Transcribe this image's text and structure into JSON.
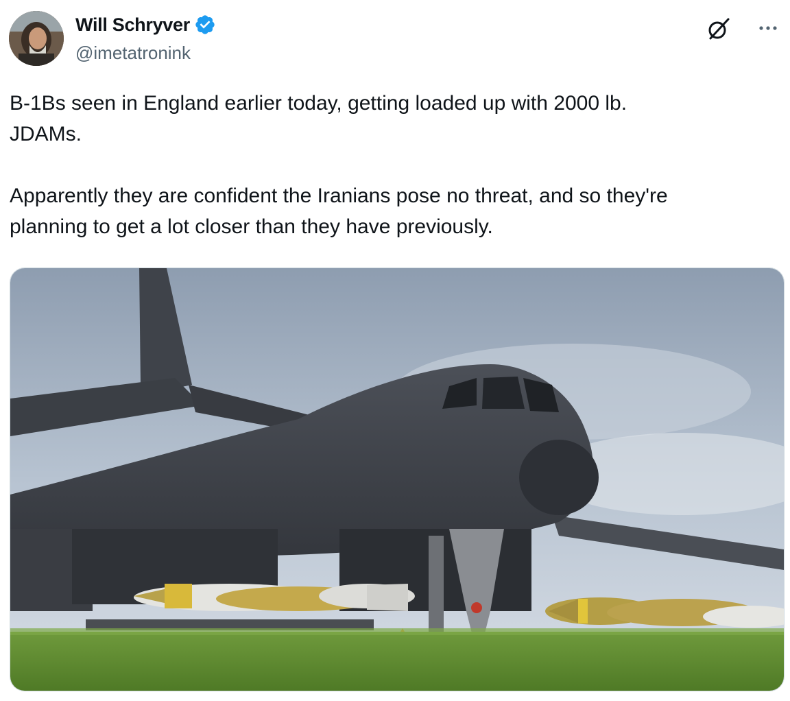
{
  "author": {
    "display_name": "Will Schryver",
    "handle": "@imetatronink",
    "verified": true,
    "avatar_icon": "profile-photo"
  },
  "actions": {
    "grok_icon": "grok-icon",
    "more_icon": "more-options-icon"
  },
  "tweet": {
    "text": "B-1Bs seen in England earlier today, getting loaded up with 2000 lb.\nJDAMs.\n\nApparently they are confident the Iranians pose no threat, and so they're\nplanning to get a lot closer than they have previously."
  },
  "media": {
    "kind": "photo",
    "subject": "B-1B bomber with JDAM bombs on grass"
  },
  "colors": {
    "verified_blue": "#1d9bf0",
    "handle_gray": "#536471",
    "text": "#0f1419"
  }
}
